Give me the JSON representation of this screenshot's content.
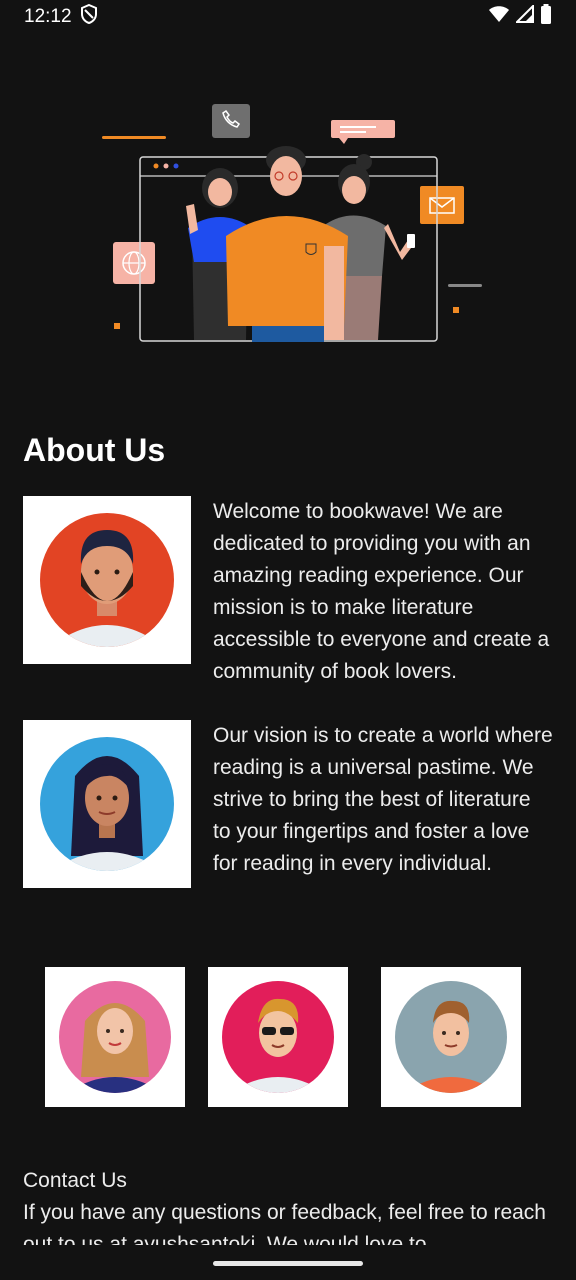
{
  "status_bar": {
    "time": "12:12"
  },
  "about": {
    "title": "About Us",
    "paragraph_1": "Welcome to bookwave! We are dedicated to providing you with an amazing reading experience. Our mission is to make literature accessible to everyone and create a community of book lovers.",
    "paragraph_2": "Our vision is to create a world where reading is a universal pastime. We strive to bring the best of literature to your fingertips and foster a love for reading in every individual."
  },
  "contact": {
    "heading": "Contact Us",
    "body": "If you have any questions or feedback, feel free to reach out to us at ayushsantoki. We would love to"
  },
  "colors": {
    "background": "#121212",
    "accent_orange": "#f08a24",
    "card": "#ffffff"
  }
}
